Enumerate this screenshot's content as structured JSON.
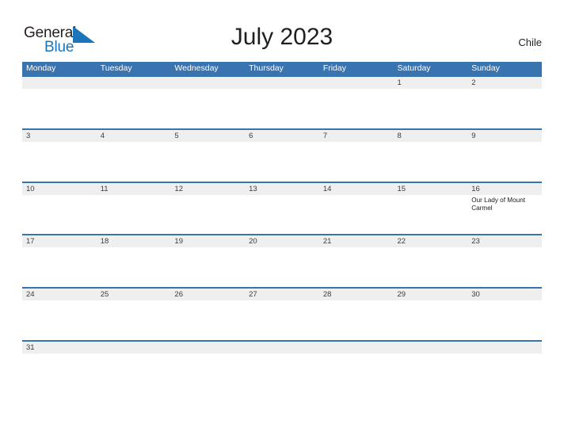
{
  "brand": {
    "name_part1": "General",
    "name_part2": "Blue",
    "triangle_color": "#1b75bb",
    "text_color": "#231f20"
  },
  "header": {
    "title": "July 2023",
    "country": "Chile"
  },
  "theme": {
    "header_blue": "#3a74b0",
    "band_gray": "#efefef",
    "cell_white": "#ffffff",
    "text_dark": "#3c3c3c"
  },
  "calendar": {
    "day_headers": [
      "Monday",
      "Tuesday",
      "Wednesday",
      "Thursday",
      "Friday",
      "Saturday",
      "Sunday"
    ],
    "weeks": [
      {
        "days": [
          {
            "date": "",
            "event": ""
          },
          {
            "date": "",
            "event": ""
          },
          {
            "date": "",
            "event": ""
          },
          {
            "date": "",
            "event": ""
          },
          {
            "date": "",
            "event": ""
          },
          {
            "date": "1",
            "event": ""
          },
          {
            "date": "2",
            "event": ""
          }
        ]
      },
      {
        "days": [
          {
            "date": "3",
            "event": ""
          },
          {
            "date": "4",
            "event": ""
          },
          {
            "date": "5",
            "event": ""
          },
          {
            "date": "6",
            "event": ""
          },
          {
            "date": "7",
            "event": ""
          },
          {
            "date": "8",
            "event": ""
          },
          {
            "date": "9",
            "event": ""
          }
        ]
      },
      {
        "days": [
          {
            "date": "10",
            "event": ""
          },
          {
            "date": "11",
            "event": ""
          },
          {
            "date": "12",
            "event": ""
          },
          {
            "date": "13",
            "event": ""
          },
          {
            "date": "14",
            "event": ""
          },
          {
            "date": "15",
            "event": ""
          },
          {
            "date": "16",
            "event": "Our Lady of Mount Carmel"
          }
        ]
      },
      {
        "days": [
          {
            "date": "17",
            "event": ""
          },
          {
            "date": "18",
            "event": ""
          },
          {
            "date": "19",
            "event": ""
          },
          {
            "date": "20",
            "event": ""
          },
          {
            "date": "21",
            "event": ""
          },
          {
            "date": "22",
            "event": ""
          },
          {
            "date": "23",
            "event": ""
          }
        ]
      },
      {
        "days": [
          {
            "date": "24",
            "event": ""
          },
          {
            "date": "25",
            "event": ""
          },
          {
            "date": "26",
            "event": ""
          },
          {
            "date": "27",
            "event": ""
          },
          {
            "date": "28",
            "event": ""
          },
          {
            "date": "29",
            "event": ""
          },
          {
            "date": "30",
            "event": ""
          }
        ]
      },
      {
        "days": [
          {
            "date": "31",
            "event": ""
          },
          {
            "date": "",
            "event": ""
          },
          {
            "date": "",
            "event": ""
          },
          {
            "date": "",
            "event": ""
          },
          {
            "date": "",
            "event": ""
          },
          {
            "date": "",
            "event": ""
          },
          {
            "date": "",
            "event": ""
          }
        ]
      }
    ]
  }
}
